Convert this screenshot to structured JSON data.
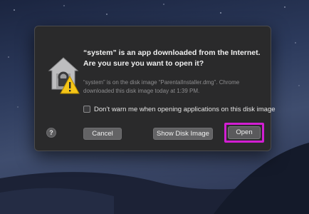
{
  "dialog": {
    "title": "“system” is an app downloaded from the Internet. Are you sure you want to open it?",
    "detail": "“system” is on the disk image “ParentalInstaller.dmg”. Chrome downloaded this disk image today at 1:39 PM.",
    "checkbox_label": "Don’t warn me when opening applications on this disk image",
    "checkbox_checked": false,
    "help_label": "?",
    "buttons": {
      "cancel": "Cancel",
      "show_disk_image": "Show Disk Image",
      "open": "Open"
    }
  },
  "icons": {
    "app": "gatekeeper-warning-icon"
  },
  "colors": {
    "highlight": "#d21ed2",
    "warning": "#f5c518"
  }
}
